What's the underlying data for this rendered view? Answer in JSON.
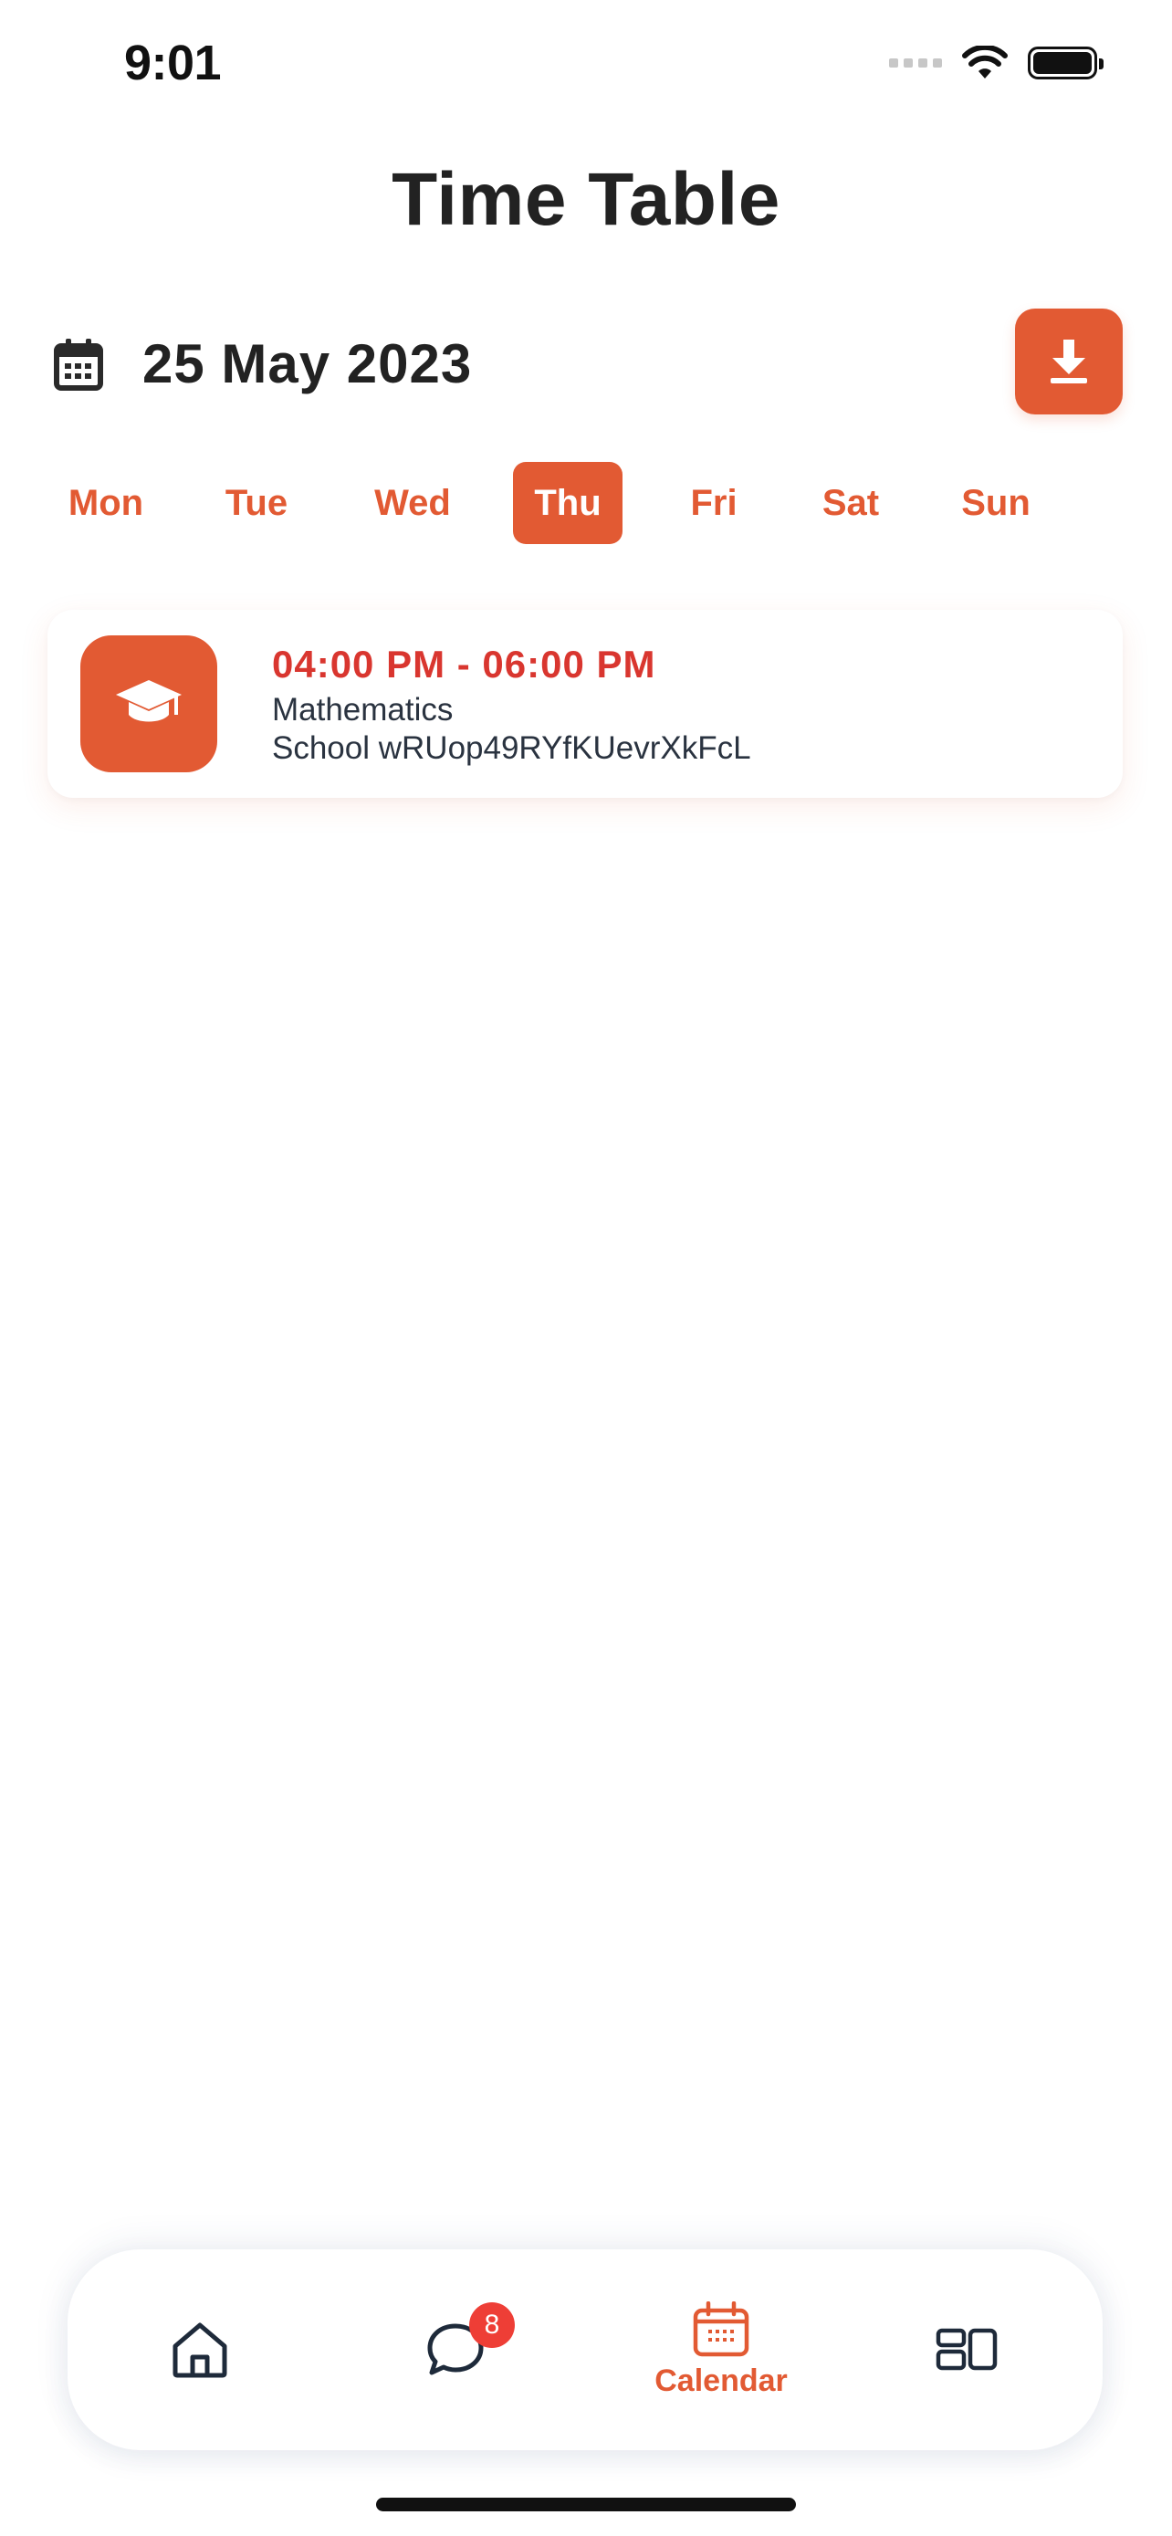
{
  "status_bar": {
    "time": "9:01"
  },
  "header": {
    "title": "Time Table"
  },
  "date_selector": {
    "date": "25 May 2023",
    "icon": "calendar-icon"
  },
  "download_button": {
    "icon": "download-icon"
  },
  "day_tabs": {
    "selected": "Thu",
    "days": [
      "Mon",
      "Tue",
      "Wed",
      "Thu",
      "Fri",
      "Sat",
      "Sun"
    ]
  },
  "events": [
    {
      "time": "04:00 PM - 06:00 PM",
      "subject": "Mathematics",
      "school": "School wRUop49RYfKUevrXkFcL",
      "icon": "graduation-cap-icon"
    }
  ],
  "bottom_nav": {
    "items": [
      {
        "id": "home",
        "icon": "home-icon",
        "label": ""
      },
      {
        "id": "messages",
        "icon": "chat-icon",
        "label": "",
        "badge": "8"
      },
      {
        "id": "calendar",
        "icon": "calendar-icon",
        "label": "Calendar",
        "active": true
      },
      {
        "id": "dashboard",
        "icon": "dashboard-icon",
        "label": ""
      }
    ]
  },
  "colors": {
    "accent": "#e25a33",
    "time_text": "#d9362f",
    "badge": "#ee3e36"
  }
}
